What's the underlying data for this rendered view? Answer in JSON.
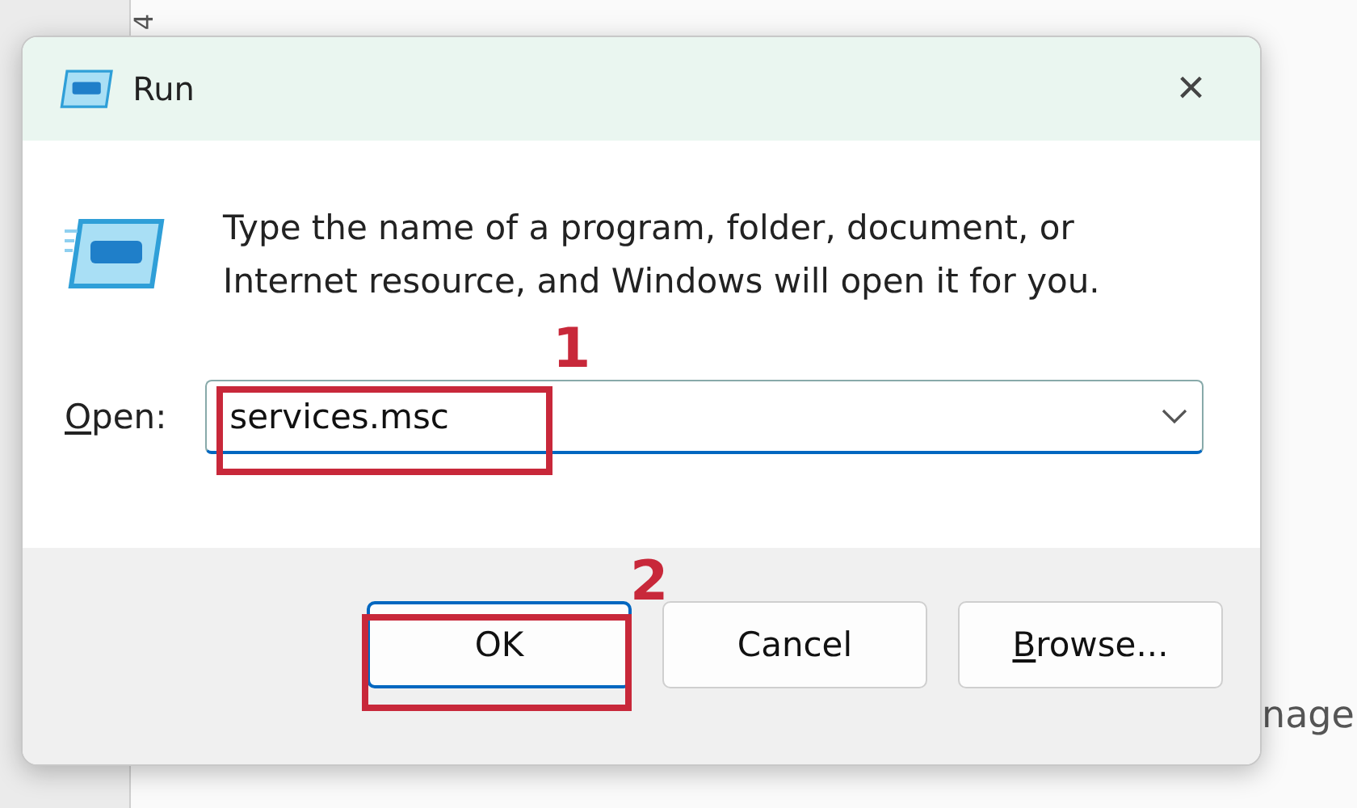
{
  "background": {
    "ruler_mark": "4",
    "behind_text": "nage"
  },
  "window": {
    "title": "Run",
    "close": "×"
  },
  "message": "Type the name of a program, folder, document, or Internet resource, and Windows will open it for you.",
  "open_field": {
    "label": "Open:",
    "access_key": true,
    "value": "services.msc",
    "annotation": "1"
  },
  "buttons": [
    {
      "label": "OK",
      "access_key": false,
      "default": true,
      "annotation": "2"
    },
    {
      "label": "Cancel",
      "access_key": false,
      "default": false
    },
    {
      "label": "Browse...",
      "access_key": true,
      "default": false
    }
  ]
}
